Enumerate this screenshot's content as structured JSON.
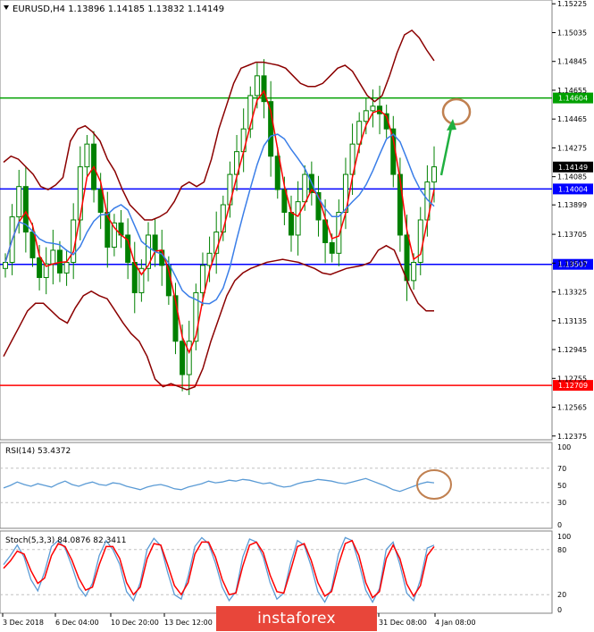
{
  "window": {
    "symbol_header": "EURUSD,H4  1.13896 1.14185 1.13832 1.14149",
    "collapse_icon": "triangle-down-icon"
  },
  "watermark": {
    "text": "instaforex"
  },
  "colors": {
    "candles": "#008000",
    "bollinger": "#8b0000",
    "fast_ma": "#ff0000",
    "slow_ma": "#3a7ee8",
    "hline_green": "#00a000",
    "hline_blue": "#0000ff",
    "hline_red": "#ff0000",
    "rsi_line": "#5b9bd5",
    "stoch_main": "#5b9bd5",
    "stoch_signal": "#ff0000",
    "annotation_circle": "#c08050",
    "annotation_arrow": "#20b040"
  },
  "chart_data": [
    {
      "type": "candlestick",
      "title": "EURUSD,H4  1.13896 1.14185 1.13832 1.14149",
      "ylim": [
        1.1235,
        1.1525
      ],
      "y_ticks": [
        "1.15225",
        "1.15035",
        "1.14845",
        "1.14655",
        "1.14465",
        "1.14275",
        "1.14085",
        "1.13899",
        "1.13705",
        "1.13515",
        "1.13325",
        "1.13135",
        "1.12945",
        "1.12755",
        "1.12565",
        "1.12375"
      ],
      "current_price_label": "1.14149",
      "current_price": 1.14149,
      "horizontal_levels": [
        {
          "label": "1.14604",
          "value": 1.14604,
          "color": "#00a000"
        },
        {
          "label": "1.14004",
          "value": 1.14004,
          "color": "#0000ff"
        },
        {
          "label": "1.13507",
          "value": 1.13507,
          "color": "#0000ff"
        },
        {
          "label": "1.12709",
          "value": 1.12709,
          "color": "#ff0000"
        }
      ],
      "close_series": [
        1.1352,
        1.1382,
        1.1402,
        1.1372,
        1.1355,
        1.1342,
        1.1351,
        1.136,
        1.1345,
        1.1352,
        1.138,
        1.1415,
        1.143,
        1.14,
        1.1385,
        1.1362,
        1.1378,
        1.137,
        1.1352,
        1.1332,
        1.1348,
        1.137,
        1.136,
        1.135,
        1.133,
        1.13,
        1.1278,
        1.13,
        1.1332,
        1.135,
        1.1358,
        1.1372,
        1.139,
        1.141,
        1.1425,
        1.144,
        1.1462,
        1.1475,
        1.1458,
        1.1422,
        1.14,
        1.1385,
        1.137,
        1.1392,
        1.141,
        1.1398,
        1.138,
        1.1365,
        1.1358,
        1.1385,
        1.141,
        1.143,
        1.1445,
        1.1452,
        1.1455,
        1.145,
        1.144,
        1.141,
        1.137,
        1.134,
        1.1352,
        1.138,
        1.1405,
        1.1415
      ],
      "bollinger_upper": [
        1.1418,
        1.1422,
        1.142,
        1.1415,
        1.141,
        1.1402,
        1.14,
        1.1403,
        1.1408,
        1.1432,
        1.144,
        1.1442,
        1.1438,
        1.1432,
        1.142,
        1.1412,
        1.14,
        1.139,
        1.1385,
        1.138,
        1.138,
        1.1382,
        1.1385,
        1.1392,
        1.1402,
        1.1405,
        1.1402,
        1.1405,
        1.142,
        1.144,
        1.1455,
        1.147,
        1.148,
        1.1482,
        1.1484,
        1.1484,
        1.1483,
        1.1482,
        1.148,
        1.1475,
        1.147,
        1.1468,
        1.1468,
        1.147,
        1.1475,
        1.148,
        1.1482,
        1.1478,
        1.147,
        1.1462,
        1.1458,
        1.1462,
        1.1475,
        1.149,
        1.1502,
        1.1505,
        1.15,
        1.1492,
        1.1485
      ],
      "bollinger_lower": [
        1.129,
        1.13,
        1.131,
        1.132,
        1.1325,
        1.1325,
        1.132,
        1.1315,
        1.1312,
        1.1322,
        1.133,
        1.1333,
        1.133,
        1.1328,
        1.132,
        1.1312,
        1.1305,
        1.13,
        1.129,
        1.1275,
        1.127,
        1.1272,
        1.127,
        1.1268,
        1.127,
        1.1282,
        1.13,
        1.1315,
        1.133,
        1.134,
        1.1345,
        1.1348,
        1.135,
        1.1352,
        1.1353,
        1.1354,
        1.1353,
        1.1352,
        1.135,
        1.1348,
        1.1345,
        1.1344,
        1.1346,
        1.1348,
        1.1349,
        1.135,
        1.1352,
        1.136,
        1.1363,
        1.136,
        1.1348,
        1.1335,
        1.1325,
        1.132,
        1.132
      ],
      "x_axis_labels": [
        "3 Dec 2018",
        "6 Dec 04:00",
        "10 Dec 20:00",
        "13 Dec 12:00",
        "31 Dec 08:00",
        "4 Jan 08:00"
      ]
    },
    {
      "type": "line",
      "title": "RSI(14) 53.4372",
      "ylim": [
        0,
        100
      ],
      "y_ticks": [
        "100",
        "70",
        "50",
        "30",
        "0"
      ],
      "levels": [
        70,
        30
      ],
      "values": [
        47,
        50,
        54,
        51,
        49,
        52,
        50,
        48,
        52,
        55,
        51,
        49,
        52,
        54,
        51,
        50,
        53,
        52,
        49,
        47,
        45,
        48,
        50,
        51,
        49,
        46,
        45,
        48,
        50,
        52,
        55,
        53,
        54,
        56,
        55,
        57,
        56,
        54,
        52,
        53,
        50,
        48,
        49,
        52,
        54,
        55,
        57,
        56,
        55,
        53,
        52,
        54,
        56,
        58,
        55,
        52,
        49,
        45,
        43,
        46,
        49,
        52,
        54,
        53
      ]
    },
    {
      "type": "line",
      "title": "Stoch(5,3,3) 84.0876 82.3411",
      "ylim": [
        0,
        100
      ],
      "y_ticks": [
        "100",
        "80",
        "20",
        "0"
      ],
      "levels": [
        80,
        20
      ],
      "series": [
        {
          "values": [
            60,
            72,
            86,
            70,
            40,
            25,
            50,
            84,
            92,
            82,
            58,
            30,
            18,
            35,
            72,
            92,
            80,
            60,
            24,
            12,
            36,
            80,
            95,
            85,
            50,
            20,
            14,
            44,
            84,
            96,
            88,
            62,
            30,
            12,
            24,
            70,
            94,
            90,
            70,
            36,
            14,
            22,
            62,
            92,
            86,
            58,
            24,
            10,
            28,
            74,
            96,
            92,
            62,
            26,
            10,
            28,
            80,
            90,
            60,
            22,
            12,
            40,
            82,
            86
          ]
        },
        {
          "values": [
            55,
            65,
            78,
            74,
            52,
            35,
            42,
            72,
            88,
            84,
            66,
            42,
            26,
            30,
            60,
            84,
            84,
            68,
            36,
            20,
            30,
            68,
            88,
            86,
            60,
            32,
            20,
            36,
            74,
            90,
            90,
            70,
            40,
            20,
            22,
            58,
            86,
            90,
            76,
            46,
            24,
            22,
            52,
            84,
            88,
            66,
            36,
            18,
            24,
            60,
            88,
            92,
            72,
            36,
            16,
            24,
            68,
            86,
            68,
            34,
            18,
            32,
            72,
            84
          ]
        }
      ]
    }
  ]
}
